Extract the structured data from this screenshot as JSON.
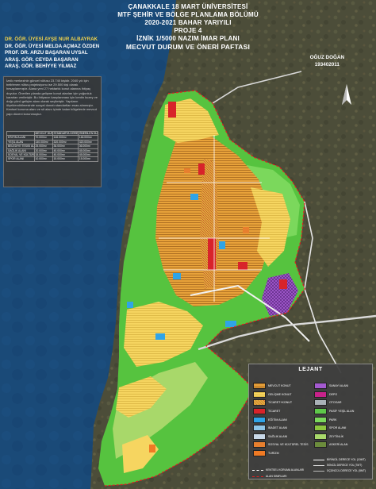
{
  "header": {
    "line1": "ÇANAKKALE 18 MART ÜNİVERSİTESİ",
    "line2": "MTF ŞEHİR VE BÖLGE PLANLAMA BÖLÜMÜ",
    "line3": "2020-2021 BAHAR YARIYILI",
    "line4": "PROJE 4",
    "line5": "İZNİK 1/5000 NAZIM İMAR PLANI",
    "line6": "MECVUT DURUM VE ÖNERİ PAFTASI"
  },
  "advisors": [
    "DR. ÖĞR. ÜYESİ AYŞE NUR ALBAYRAK",
    "DR. ÖĞR. ÜYESİ MELDA AÇMAZ ÖZDEN",
    "PROF. DR. ARZU BAŞARAN UYSAL",
    "ARAŞ. GÖR. CEYDA BAŞARAN",
    "ARAŞ. GÖR. BEHİYYE YILMAZ"
  ],
  "student": {
    "name": "OĞUZ DOĞAN",
    "number": "193402011"
  },
  "info_panel": {
    "paragraph": "İznik merkezinin güncel nüfusu 23.740 kişidir. 2040 yılı için belirlenen nüfus projeksiyonu ise 29.500 kişi olarak hesaplanmıştır. Alana yeni 27 hektarlık konut alanına ihtiyaç duyulur. Önerilen planda gelişme konut alanları için yoğunluk kararları verilmiştir. Bu ihtiyacın karşılanması için kentin kuzey ve doğu yönü gelişim alanı olarak seçilmiştir. Yapıların ölçeklendirilmesinde sosyal donatı standartları esas alınmıştır. Kentsel koruma alanı ve sit alanı içinde kalan bölgelerde mevcut yapı düzeni korunmuştur.",
    "columns": [
      "",
      "MEVCUT DURUM",
      "STANDARTA GÖRE OLMASI GEREKEN DURUM",
      "ÖNERİLEN DURUM"
    ],
    "rows": [
      [
        "EĞİTİM ALANI",
        "70.000m²",
        "146.000m²",
        "146.000m²"
      ],
      [
        "YEŞİL ALAN",
        "140.000m²",
        "320.000m²",
        "320.000m²"
      ],
      [
        "BELEDİYE TESİSİ ALANI",
        "25.000m²",
        "36.000m²",
        "36.000m²"
      ],
      [
        "SAĞLIK ALANI",
        "20.000m²",
        "45.000m²",
        "45.000m²"
      ],
      [
        "SOSYAL VE KÜLTÜREL TESİS ALANI",
        "15.000m²",
        "45.000m²",
        "45.000m²"
      ],
      [
        "SPOR ALANI",
        "10.000m²",
        "15.000m²",
        "15.000m²"
      ]
    ]
  },
  "legend": {
    "title": "LEJANT",
    "left_items": [
      {
        "label": "MEVCUT KONUT",
        "color": "#e8a23a",
        "pattern": "hatch-brown"
      },
      {
        "label": "GELİŞME KONUT",
        "color": "#f6d560",
        "pattern": "hatch-light"
      },
      {
        "label": "TİCARET+KONUT",
        "color": "#e0b03c",
        "pattern": "hatch-red"
      },
      {
        "label": "TİCARET",
        "color": "#d8232a",
        "pattern": "none"
      },
      {
        "label": "EĞİTİM ALANI",
        "color": "#2fa4e7",
        "pattern": "none"
      },
      {
        "label": "İBADET ALANI",
        "color": "#8fc6e8",
        "pattern": "none"
      },
      {
        "label": "SAĞLIK ALANI",
        "color": "#c8d8e8",
        "pattern": "none"
      },
      {
        "label": "SOSYAL VE KÜLTÜREL TESİS",
        "color": "#e77f2e",
        "pattern": "none"
      },
      {
        "label": "TURİZM",
        "color": "#f07a24",
        "pattern": "none"
      }
    ],
    "right_items": [
      {
        "label": "SANAYİ ALANI",
        "color": "#a45ad0",
        "pattern": "none"
      },
      {
        "label": "DEPO",
        "color": "#c8228a",
        "pattern": "none"
      },
      {
        "label": "OTOGAR",
        "color": "#aab2b8",
        "pattern": "none"
      },
      {
        "label": "PASİF YEŞİL ALAN",
        "color": "#5ec84a",
        "pattern": "none"
      },
      {
        "label": "PARK",
        "color": "#7bd85c",
        "pattern": "none"
      },
      {
        "label": "SPOR ALANI",
        "color": "#8cc63f",
        "pattern": "none"
      },
      {
        "label": "ZEYTİNLİK",
        "color": "#a8d86a",
        "pattern": "none"
      },
      {
        "label": "ASKERİ ALAN",
        "color": "#6c8c3c",
        "pattern": "none"
      }
    ],
    "line_items": [
      {
        "label": "BİRİNCİL DERECE YOL (10MT)",
        "color": "#ffffff",
        "style": "solid"
      },
      {
        "label": "İKİNCİL DERECE YOL (7MT)",
        "color": "#dddddd",
        "style": "solid"
      },
      {
        "label": "ÜÇÜNCÜL DERECE YOL (5MT)",
        "color": "#bbbbbb",
        "style": "solid"
      },
      {
        "label": "KENTSEL KORUMA ALANLARI",
        "color": "#ffffff",
        "style": "dashed"
      },
      {
        "label": "ALAN SINIRLARI",
        "color": "#e02020",
        "style": "dashed"
      }
    ]
  },
  "map": {
    "lake_color": "#1a4a78",
    "green_color": "#56c33f",
    "north_arrow": "north-arrow-icon"
  }
}
